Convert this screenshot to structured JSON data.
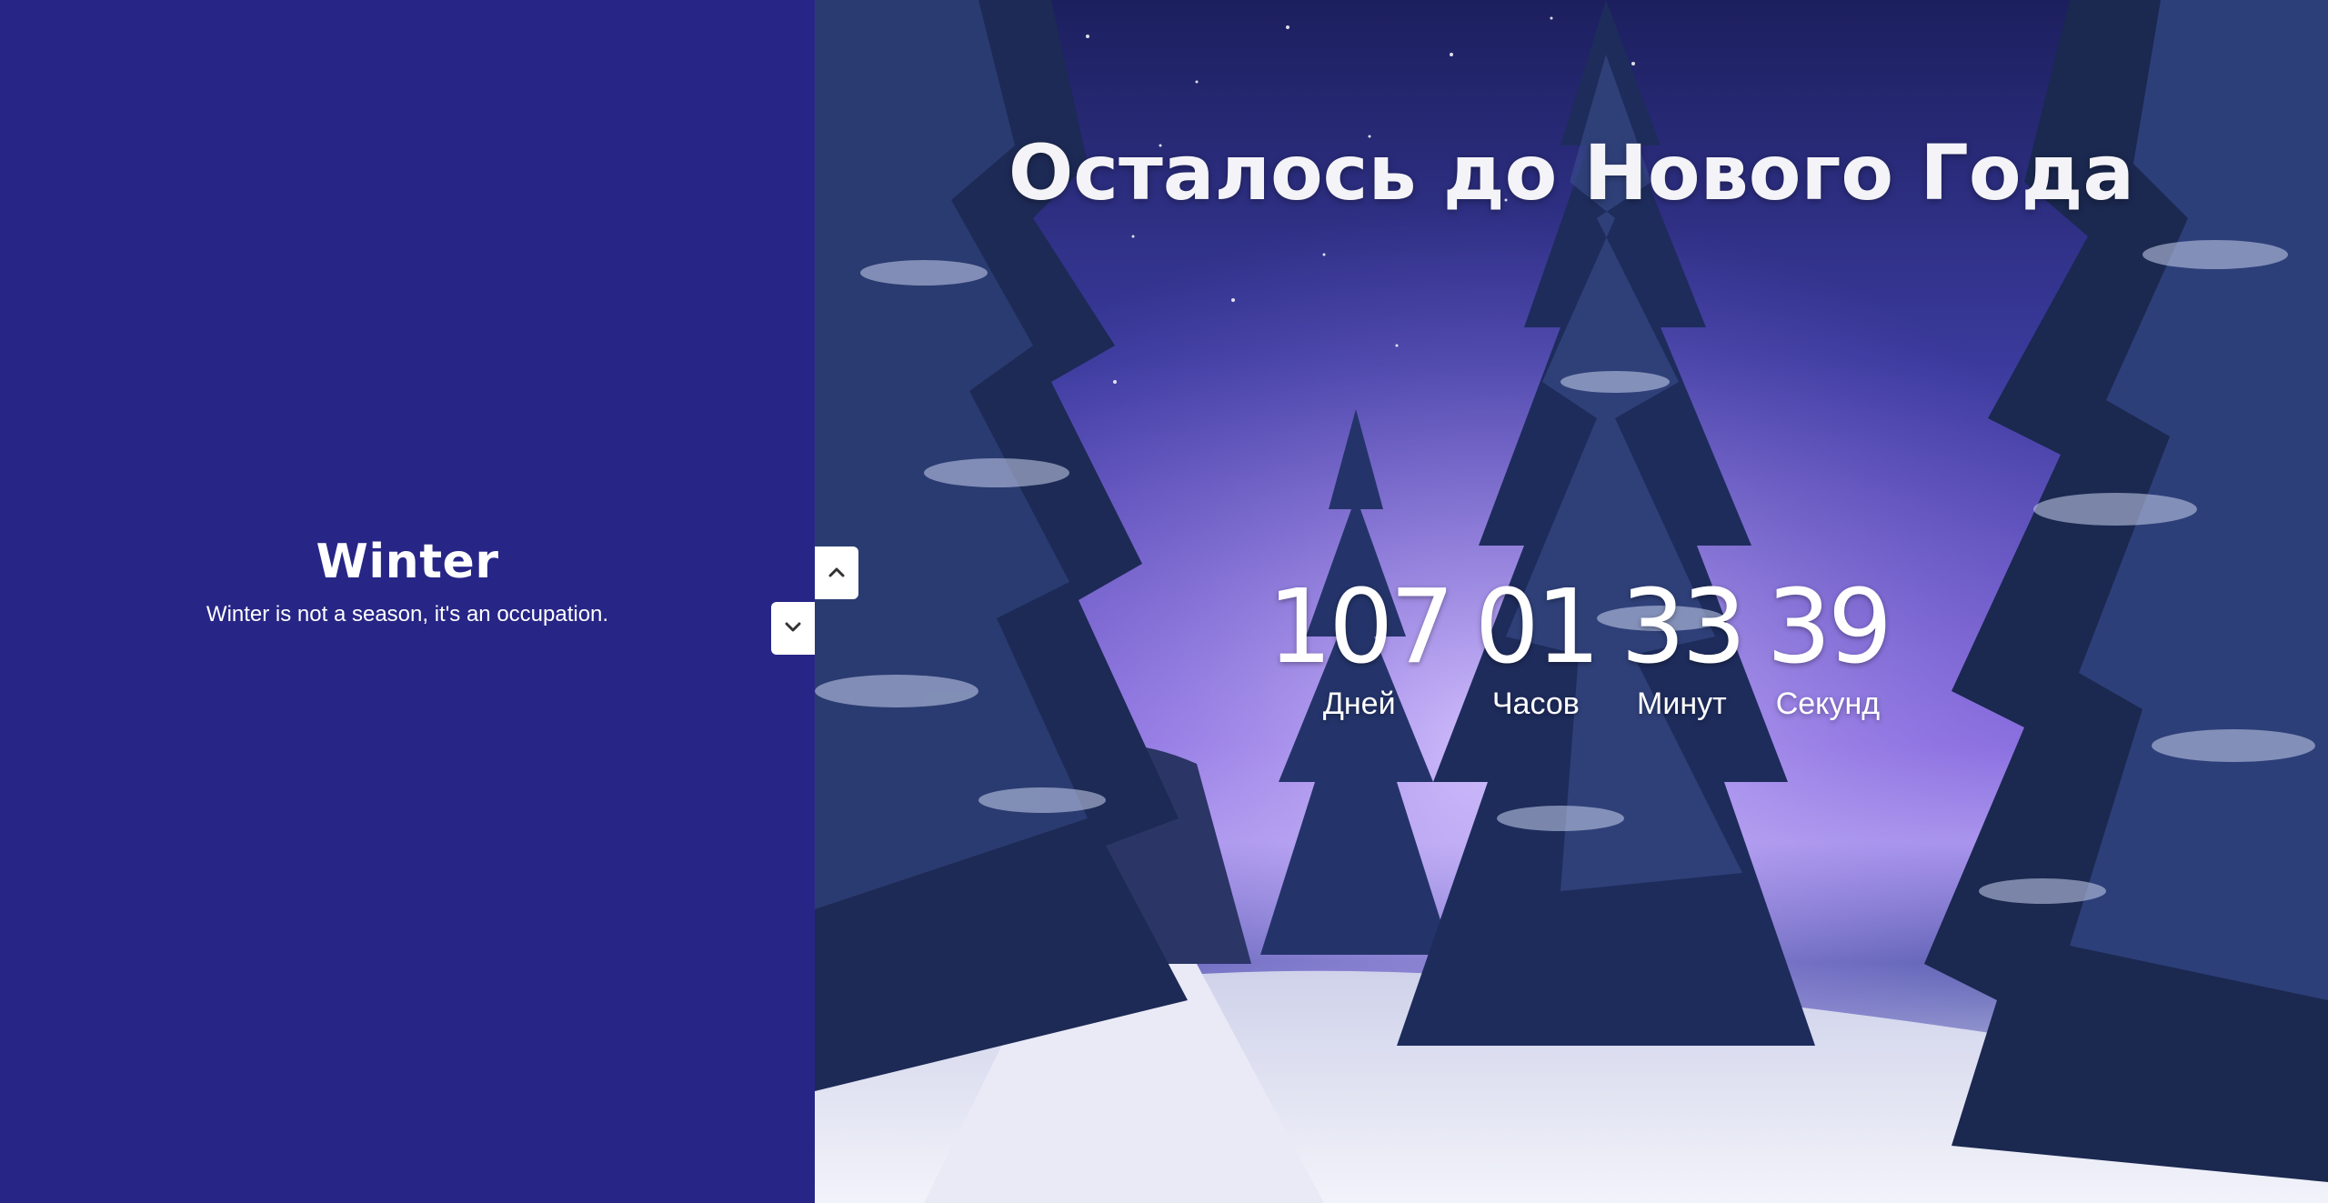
{
  "slide": {
    "title": "Winter",
    "description": "Winter is not a season, it's an occupation."
  },
  "controls": {
    "up_icon": "chevron-up-icon",
    "down_icon": "chevron-down-icon"
  },
  "countdown": {
    "heading": "Осталось до Нового Года",
    "days": {
      "value": "107",
      "label": "Дней"
    },
    "hours": {
      "value": "01",
      "label": "Часов"
    },
    "minutes": {
      "value": "33",
      "label": "Минут"
    },
    "seconds": {
      "value": "39",
      "label": "Секунд"
    }
  },
  "colors": {
    "panel_background": "#272686",
    "text": "#ffffff",
    "button": "#ffffff"
  }
}
